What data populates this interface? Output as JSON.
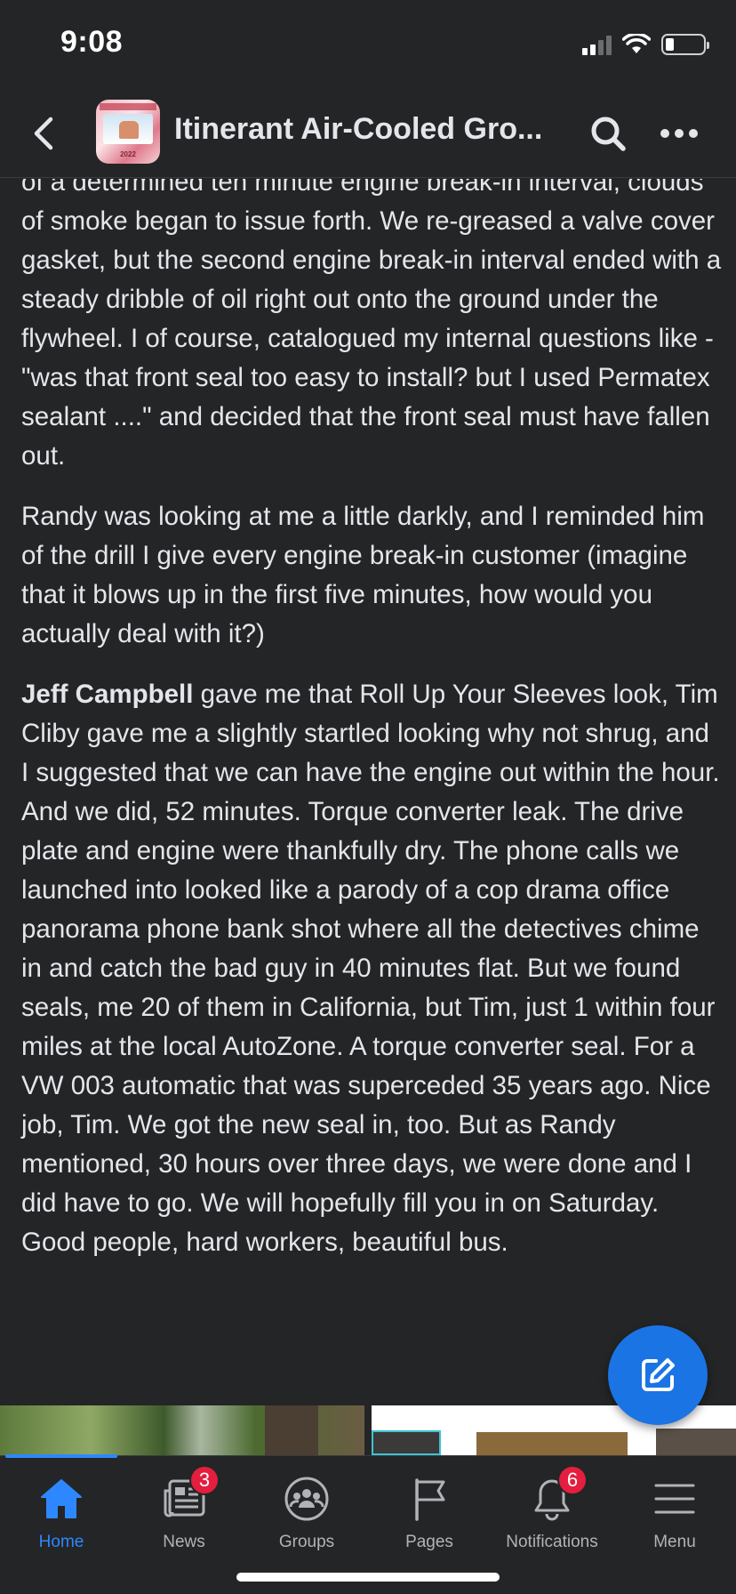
{
  "status_bar": {
    "time": "9:08"
  },
  "header": {
    "group_name": "Itinerant Air-Cooled Gro...",
    "avatar_year": "2022"
  },
  "post": {
    "paragraphs": [
      "of a determined ten minute engine break-in interval, clouds of smoke began to issue forth. We re-greased a valve cover gasket, but the second engine break-in interval ended with a steady dribble of oil right out onto the ground under the flywheel. I of course, catalogued my internal questions like - \"was that front seal too easy to install? but I used Permatex sealant ....\" and decided that the front seal must have fallen out.",
      "Randy was looking at me a little darkly, and I reminded him of the drill I give every engine break-in customer (imagine that it blows up in the first five minutes, how would you actually deal with it?)"
    ],
    "p3_mention": "Jeff Campbell",
    "p3_text": " gave me that Roll Up Your Sleeves look, Tim Cliby gave me a slightly startled looking why not shrug, and I suggested that we can have the engine out within the hour. And we did, 52 minutes. Torque converter leak. The drive plate and engine were thankfully dry. The phone calls we launched into looked like a parody of a cop drama office panorama phone bank shot where all the detectives chime in and catch the bad guy in 40 minutes flat. But we found seals, me 20 of them in California, but Tim, just 1 within four miles at the local AutoZone. A torque converter seal. For a VW 003 automatic that was superceded 35 years ago. Nice job, Tim. We got the new seal in, too. But as Randy mentioned, 30 hours over three days, we were done and I did have to go. We will hopefully fill you in on Saturday. Good people, hard workers, beautiful bus."
  },
  "nav": {
    "items": [
      {
        "label": "Home",
        "icon": "home-icon",
        "active": true
      },
      {
        "label": "News",
        "icon": "news-icon",
        "badge": "3"
      },
      {
        "label": "Groups",
        "icon": "groups-icon"
      },
      {
        "label": "Pages",
        "icon": "flag-icon"
      },
      {
        "label": "Notifications",
        "icon": "bell-icon",
        "badge": "6"
      },
      {
        "label": "Menu",
        "icon": "menu-icon"
      }
    ]
  },
  "colors": {
    "background": "#242526",
    "text": "#e4e6eb",
    "accent": "#2d88ff",
    "fab": "#1b74e4",
    "badge": "#e41e3f"
  }
}
